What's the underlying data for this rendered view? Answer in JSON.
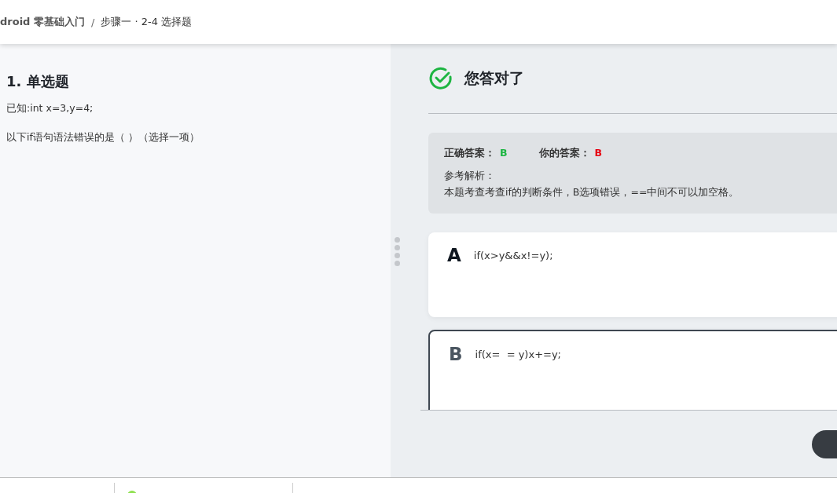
{
  "breadcrumb": {
    "course": "droid 零基础入门",
    "separator": "/",
    "step": "步骤一 · 2-4 选择题"
  },
  "question": {
    "title": "1. 单选题",
    "lines": [
      "已知:int x=3,y=4;",
      "以下if语句语法错误的是（ ）（选择一项）"
    ]
  },
  "result": {
    "title": "您答对了",
    "correct_label": "正确答案：",
    "correct_answer": "B",
    "your_label": "你的答案：",
    "your_answer": "B",
    "analysis_label": "参考解析：",
    "analysis": "本题考查考查if的判断条件，B选项错误，==中间不可以加空格。"
  },
  "options": [
    {
      "letter": "A",
      "text": "if(x>y&&x!=y);",
      "selected": false
    },
    {
      "letter": "B",
      "text": "if(x=  = y)x+=y;",
      "selected": true
    }
  ]
}
